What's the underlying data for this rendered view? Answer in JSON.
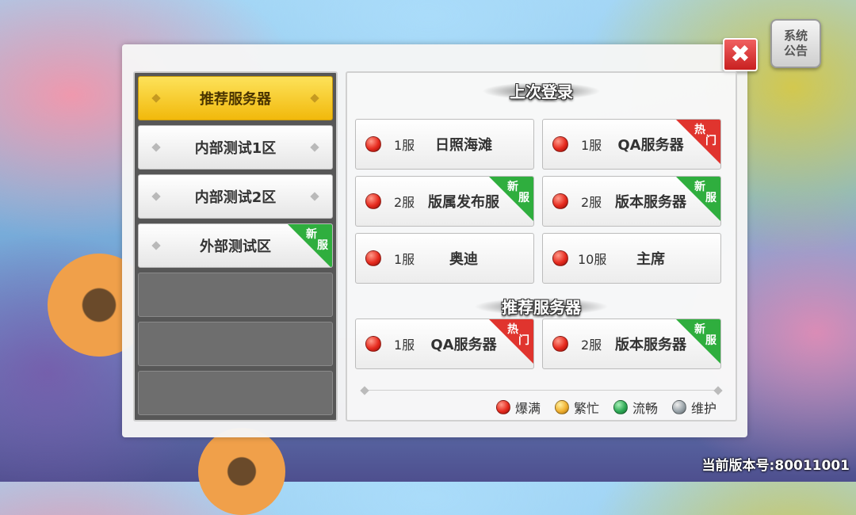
{
  "notice_button": {
    "line1": "系统",
    "line2": "公告"
  },
  "close_label": "✖",
  "sidebar": {
    "items": [
      {
        "label": "推荐服务器",
        "state": "active",
        "tag": ""
      },
      {
        "label": "内部测试1区",
        "state": "normal",
        "tag": ""
      },
      {
        "label": "内部测试2区",
        "state": "normal",
        "tag": ""
      },
      {
        "label": "外部测试区",
        "state": "normal",
        "tag": "new"
      }
    ],
    "empty_slots": 3
  },
  "tags": {
    "new": {
      "a": "新",
      "b": "服",
      "color": "#2fae3e"
    },
    "hot": {
      "a": "热",
      "b": "门",
      "color": "#e0342e"
    }
  },
  "last_login": {
    "title": "上次登录",
    "servers": [
      {
        "num": "1服",
        "name": "日照海滩",
        "status": "red",
        "tag": ""
      },
      {
        "num": "1服",
        "name": "QA服务器",
        "status": "red",
        "tag": "hot"
      },
      {
        "num": "2服",
        "name": "版属发布服",
        "status": "red",
        "tag": "new"
      },
      {
        "num": "2服",
        "name": "版本服务器",
        "status": "red",
        "tag": "new"
      },
      {
        "num": "1服",
        "name": "奥迪",
        "status": "red",
        "tag": ""
      },
      {
        "num": "10服",
        "name": "主席",
        "status": "red",
        "tag": ""
      }
    ]
  },
  "recommended": {
    "title": "推荐服务器",
    "servers": [
      {
        "num": "1服",
        "name": "QA服务器",
        "status": "red",
        "tag": "hot"
      },
      {
        "num": "2服",
        "name": "版本服务器",
        "status": "red",
        "tag": "new"
      }
    ]
  },
  "legend": [
    {
      "status": "red",
      "label": "爆满"
    },
    {
      "status": "yellow",
      "label": "繁忙"
    },
    {
      "status": "green",
      "label": "流畅"
    },
    {
      "status": "gray",
      "label": "维护"
    }
  ],
  "version_text": "当前版本号:80011001"
}
